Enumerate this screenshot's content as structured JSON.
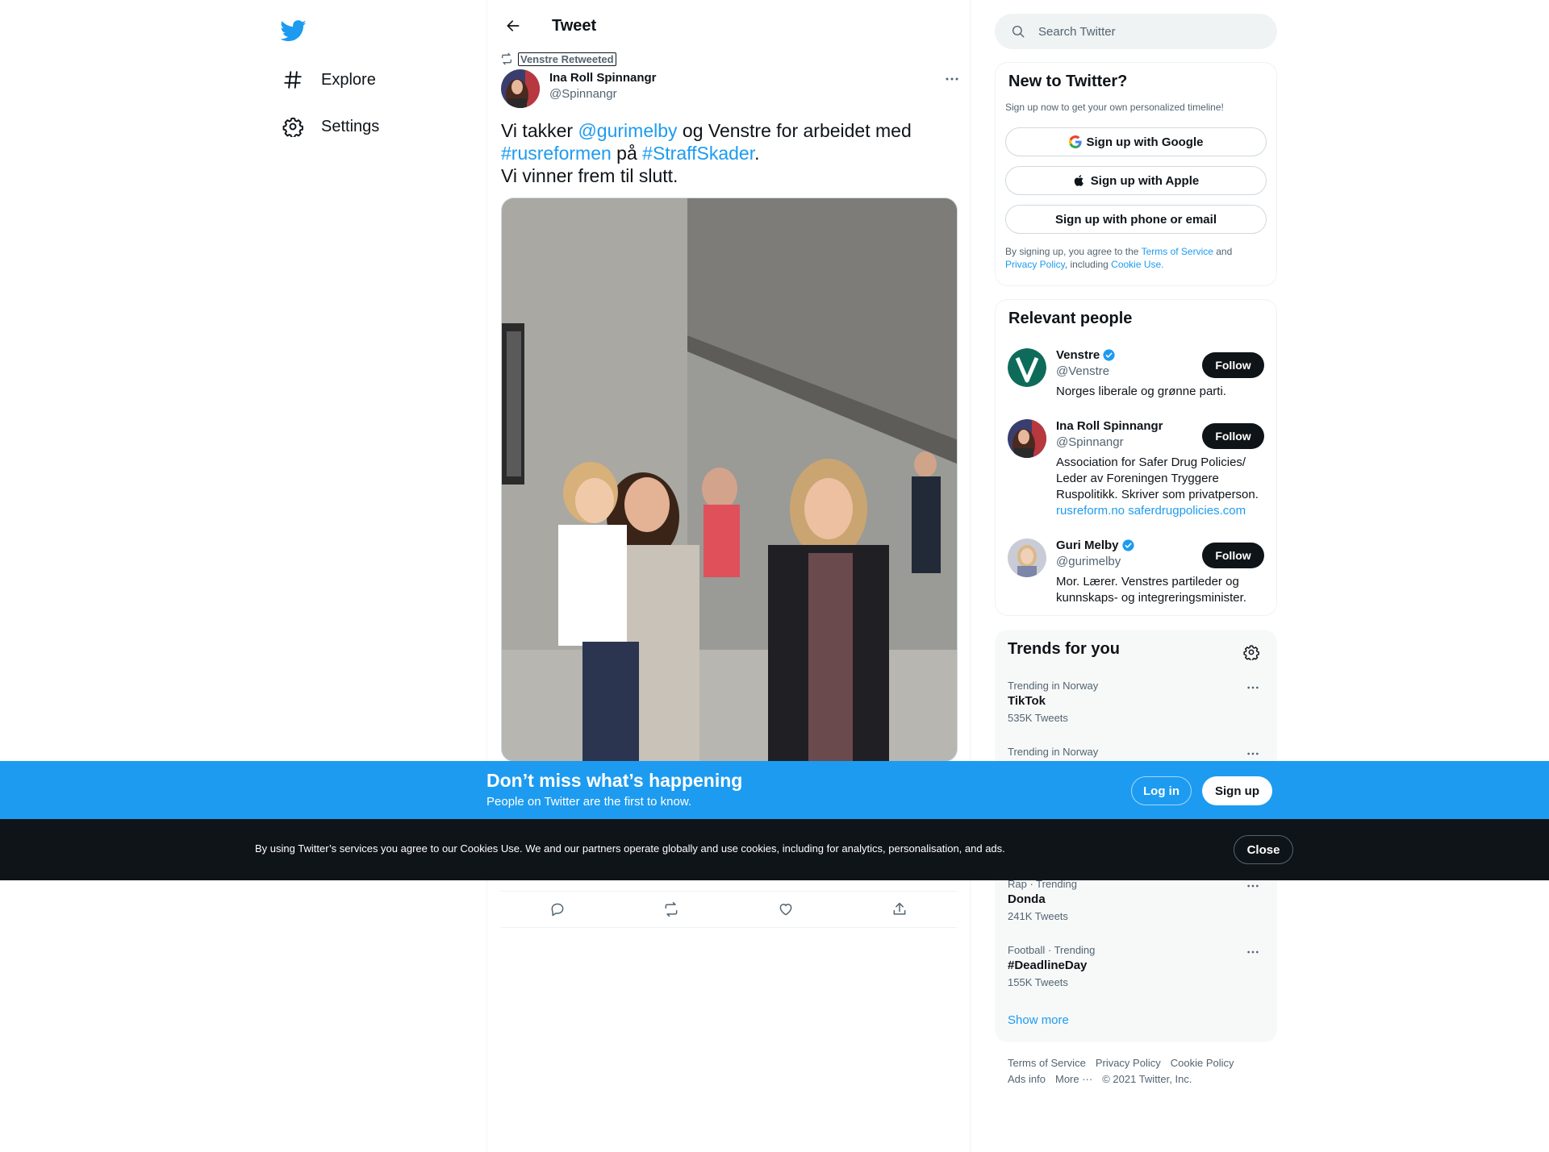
{
  "nav": {
    "items": [
      {
        "label": "Explore",
        "icon": "hashtag-icon"
      },
      {
        "label": "Settings",
        "icon": "gear-icon"
      }
    ]
  },
  "header": {
    "title": "Tweet"
  },
  "tweet": {
    "retweet_context": "Venstre Retweeted",
    "author_name": "Ina Roll Spinnangr",
    "author_handle": "@Spinnangr",
    "text_parts": {
      "p1": "Vi takker ",
      "mention": "@gurimelby",
      "p2": " og Venstre for arbeidet med",
      "hashtag1": "#rusreformen",
      "p3": " på ",
      "hashtag2": "#StraffSkader",
      "p4": ".",
      "line2": "Vi vinner frem til slutt."
    }
  },
  "search": {
    "placeholder": "Search Twitter"
  },
  "new_to_twitter": {
    "title": "New to Twitter?",
    "subtitle": "Sign up now to get your own personalized timeline!",
    "google": "Sign up with Google",
    "apple": "Sign up with Apple",
    "phone": "Sign up with phone or email",
    "legal_1": "By signing up, you agree to the ",
    "tos": "Terms of Service",
    "legal_2": " and",
    "privacy": "Privacy Policy",
    "legal_3": ", including ",
    "cookie_use": "Cookie Use."
  },
  "relevant_people": {
    "title": "Relevant people",
    "follow_label": "Follow",
    "people": [
      {
        "name": "Venstre",
        "handle": "@Venstre",
        "verified": true,
        "bio": "Norges liberale og grønne parti."
      },
      {
        "name": "Ina Roll Spinnangr",
        "handle": "@Spinnangr",
        "verified": false,
        "bio": "Association for Safer Drug Policies/ Leder av Foreningen Tryggere Ruspolitikk. Skriver som privatperson.",
        "links": [
          "rusreform.no",
          "saferdrugpolicies.com"
        ]
      },
      {
        "name": "Guri Melby",
        "handle": "@gurimelby",
        "verified": true,
        "bio": "Mor. Lærer. Venstres partileder og kunnskaps- og integreringsminister."
      }
    ]
  },
  "trends": {
    "title": "Trends for you",
    "items": [
      {
        "meta": "Trending in Norway",
        "name": "TikTok",
        "count": "535K Tweets"
      },
      {
        "meta": "Trending in Norway",
        "name": "",
        "count": ""
      },
      {
        "meta": "Rap · Trending",
        "name": "Donda",
        "count": "241K Tweets"
      },
      {
        "meta": "Football · Trending",
        "name": "#DeadlineDay",
        "count": "155K Tweets"
      }
    ],
    "show_more": "Show more"
  },
  "footer": {
    "links": [
      "Terms of Service",
      "Privacy Policy",
      "Cookie Policy",
      "Ads info",
      "More ···"
    ],
    "copyright": "© 2021 Twitter, Inc."
  },
  "signup_bar": {
    "title": "Don’t miss what’s happening",
    "subtitle": "People on Twitter are the first to know.",
    "login": "Log in",
    "signup": "Sign up"
  },
  "cookie_bar": {
    "text": "By using Twitter’s services you agree to our Cookies Use. We and our partners operate globally and use cookies, including for analytics, personalisation, and ads.",
    "close": "Close"
  },
  "colors": {
    "accent": "#1d9bf0",
    "text": "#0f1419",
    "secondary": "#536471",
    "cookie_bg": "#0f1419"
  }
}
